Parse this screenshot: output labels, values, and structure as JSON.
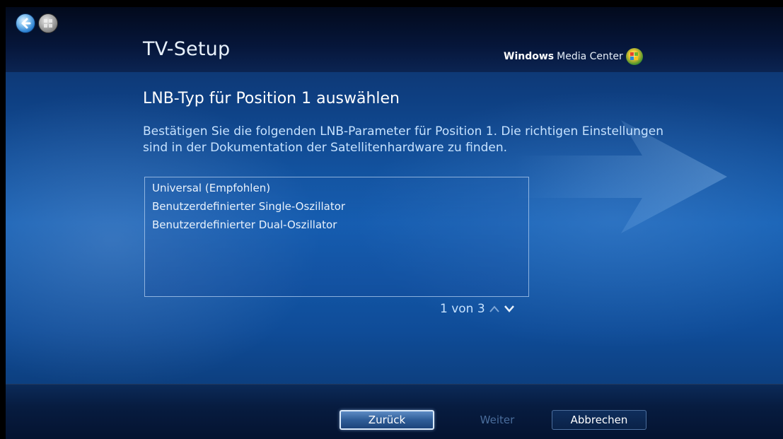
{
  "window": {
    "nav_back_icon": "back-arrow-icon",
    "start_icon": "windows-start-icon"
  },
  "header": {
    "title": "TV-Setup",
    "brand_bold": "Windows",
    "brand_rest": "Media Center",
    "brand_icon": "windows-flag-icon"
  },
  "content": {
    "heading": "LNB-Typ für Position 1 auswählen",
    "description": "Bestätigen Sie die folgenden LNB-Parameter für Position 1. Die richtigen Einstellungen sind in der Dokumentation der Satellitenhardware zu finden.",
    "options": [
      "Universal (Empfohlen)",
      "Benutzerdefinierter Single-Oszillator",
      "Benutzerdefinierter Dual-Oszillator"
    ],
    "pager": "1 von 3"
  },
  "footer": {
    "back_label": "Zurück",
    "next_label": "Weiter",
    "cancel_label": "Abbrechen"
  },
  "colors": {
    "background": "#1560b4",
    "text_primary": "#ffffff",
    "text_accent": "#c6e2ff",
    "disabled": "#4a6d9c"
  }
}
